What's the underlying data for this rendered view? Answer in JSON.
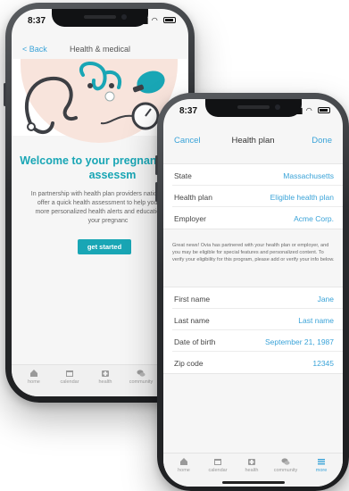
{
  "back_phone": {
    "status_time": "8:37",
    "nav": {
      "back_label": "< Back",
      "title": "Health & medical"
    },
    "welcome_title": "Welcome to your pregnancy health assessm",
    "intro_text": "In partnership with health plan providers nationwide, we offer a quick health assessment to help you access more personalized health alerts and education about your pregnanc",
    "cta_label": "get started",
    "tabs": [
      {
        "label": "home",
        "icon": "home-icon"
      },
      {
        "label": "calendar",
        "icon": "calendar-icon"
      },
      {
        "label": "health",
        "icon": "health-kit-icon"
      },
      {
        "label": "community",
        "icon": "chat-bubbles-icon"
      }
    ]
  },
  "front_phone": {
    "status_time": "8:37",
    "nav": {
      "cancel_label": "Cancel",
      "title": "Health plan",
      "done_label": "Done"
    },
    "plan_fields": [
      {
        "label": "State",
        "value": "Massachusetts"
      },
      {
        "label": "Health plan",
        "value": "Eligible health plan"
      },
      {
        "label": "Employer",
        "value": "Acme Corp."
      }
    ],
    "note_text": "Great news! Ovia has partnered with your health plan or employer, and you may be eligible for special features and personalized content. To verify your eligibility for this program, please add or verify your info below.",
    "personal_fields": [
      {
        "label": "First name",
        "value": "Jane"
      },
      {
        "label": "Last name",
        "value": "Last name"
      },
      {
        "label": "Date of birth",
        "value": "September 21, 1987"
      },
      {
        "label": "Zip code",
        "value": "12345"
      }
    ],
    "tabs": [
      {
        "label": "home",
        "icon": "home-icon"
      },
      {
        "label": "calendar",
        "icon": "calendar-icon"
      },
      {
        "label": "health",
        "icon": "health-kit-icon"
      },
      {
        "label": "community",
        "icon": "chat-bubbles-icon"
      },
      {
        "label": "more",
        "icon": "hamburger-menu-icon"
      }
    ]
  },
  "colors": {
    "accent_teal": "#19a6b5",
    "link_blue": "#3aa3d8",
    "hero_peach": "#f8e4dc"
  }
}
